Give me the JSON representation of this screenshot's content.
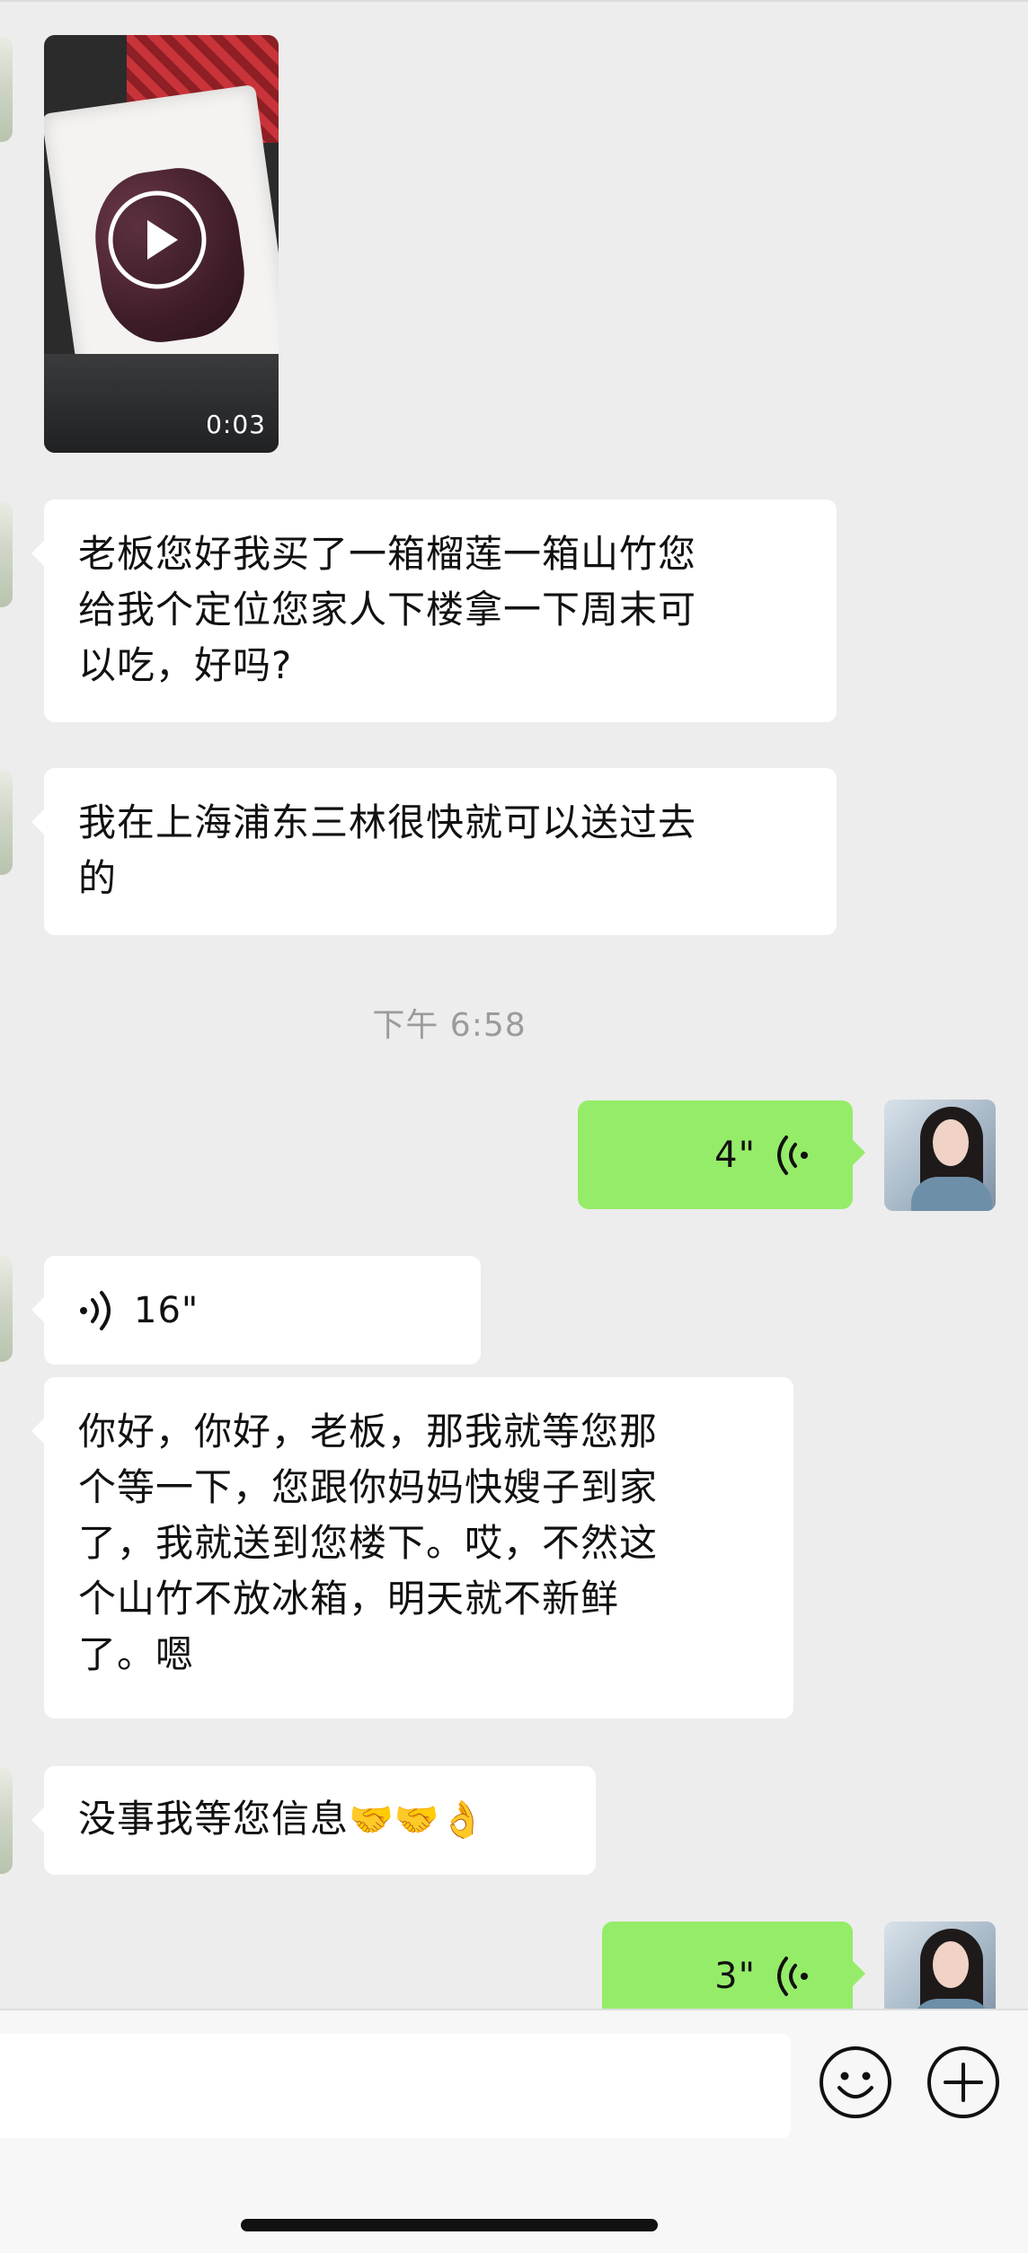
{
  "messages": {
    "video": {
      "duration": "0:03"
    },
    "text1": "老板您好我买了一箱榴莲一箱山竹您\n给我个定位您家人下楼拿一下周末可\n以吃，好吗?",
    "text2": "我在上海浦东三林很快就可以送过去\n的",
    "timestamp": "下午 6:58",
    "voice_out_1": {
      "duration": "4\""
    },
    "voice_in_1": {
      "duration": "16\""
    },
    "text3": "你好，你好，老板，那我就等您那\n个等一下，您跟你妈妈快嫂子到家\n了，我就送到您楼下。哎，不然这\n个山竹不放冰箱，明天就不新鲜\n了。嗯",
    "text4": "没事我等您信息",
    "text4_emojis": "🤝🤝👌",
    "voice_out_2": {
      "duration": "3\""
    }
  },
  "input_bar": {
    "placeholder": "",
    "icons": [
      "emoji-icon",
      "plus-icon"
    ]
  },
  "colors": {
    "background": "#ededed",
    "incoming_bubble": "#ffffff",
    "outgoing_bubble": "#95ec69",
    "timestamp": "#9b9b9b",
    "input_bar": "#f7f7f7"
  }
}
